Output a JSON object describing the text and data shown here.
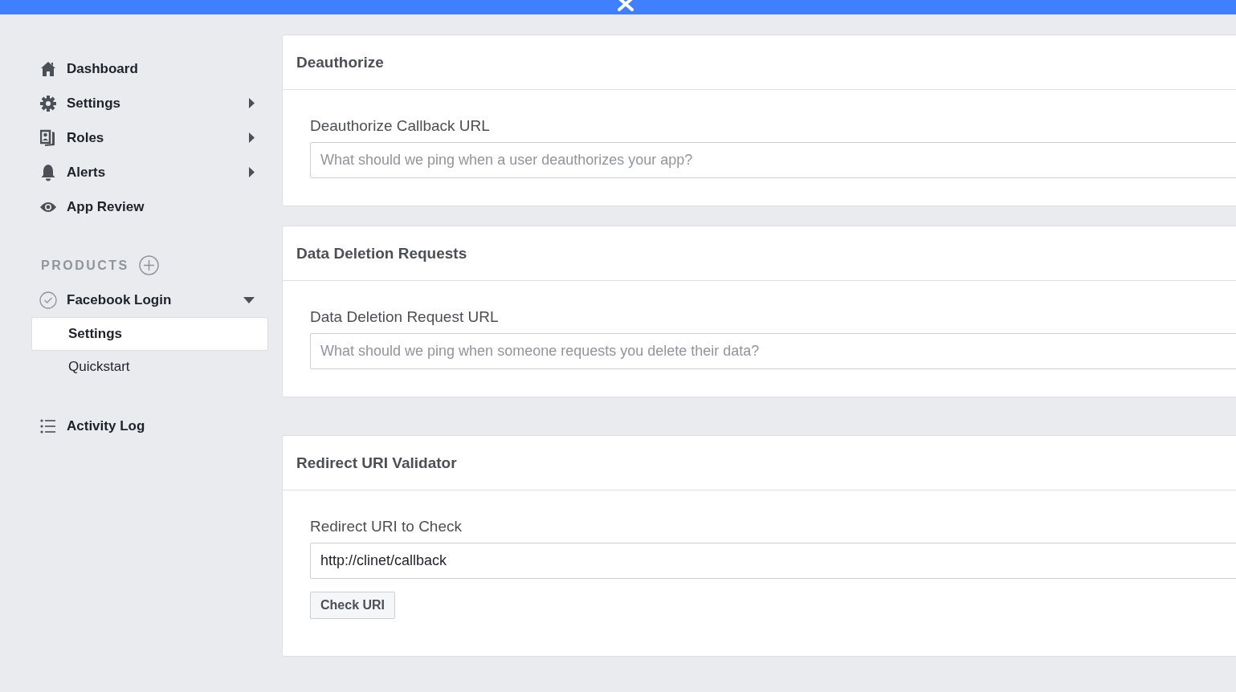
{
  "sidebar": {
    "nav": [
      {
        "label": "Dashboard",
        "has_submenu": false
      },
      {
        "label": "Settings",
        "has_submenu": true
      },
      {
        "label": "Roles",
        "has_submenu": true
      },
      {
        "label": "Alerts",
        "has_submenu": true
      },
      {
        "label": "App Review",
        "has_submenu": false
      }
    ],
    "products_heading": "PRODUCTS",
    "products": [
      {
        "label": "Facebook Login",
        "expanded": true,
        "children": [
          {
            "label": "Settings",
            "selected": true
          },
          {
            "label": "Quickstart",
            "selected": false
          }
        ]
      }
    ],
    "footer_nav": [
      {
        "label": "Activity Log"
      }
    ]
  },
  "sections": [
    {
      "title": "Deauthorize",
      "field": {
        "label": "Deauthorize Callback URL",
        "placeholder": "What should we ping when a user deauthorizes your app?"
      }
    },
    {
      "title": "Data Deletion Requests",
      "field": {
        "label": "Data Deletion Request URL",
        "placeholder": "What should we ping when someone requests you delete their data?"
      }
    },
    {
      "title": "Redirect URI Validator",
      "field": {
        "label": "Redirect URI to Check",
        "value": "http://clinet/callback"
      },
      "button": "Check URI"
    }
  ]
}
